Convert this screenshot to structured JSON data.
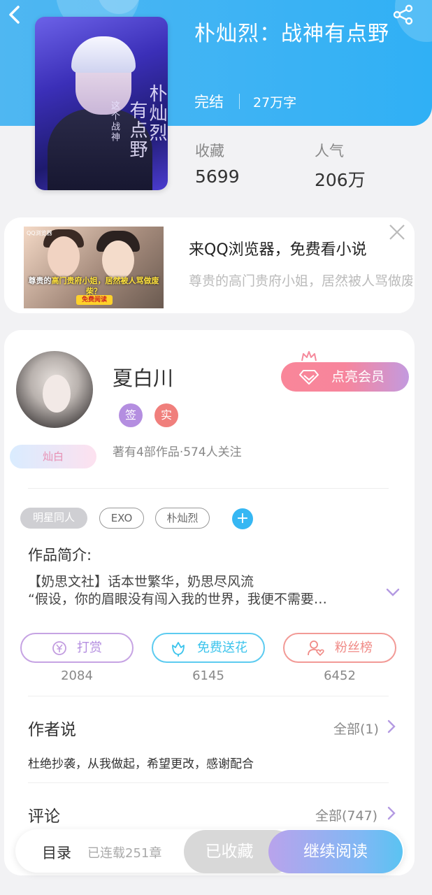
{
  "book": {
    "title": "朴灿烈：战神有点野",
    "status": "完结",
    "word_count": "27万字",
    "cover_text_1": "朴灿烈",
    "cover_text_2": "有点野",
    "cover_text_3": "这个战神",
    "stats": {
      "favorites_label": "收藏",
      "favorites_value": "5699",
      "popularity_label": "人气",
      "popularity_value": "206万"
    }
  },
  "ad": {
    "title": "来QQ浏览器，免费看小说",
    "description": "尊贵的高门贵府小姐，居然被人骂做废柴？",
    "image_caption_a": "尊贵的",
    "image_caption_b": "高门贵府小姐",
    "image_caption_c": "，居然被人骂做废柴？",
    "image_button": "免费阅读",
    "image_logo": "QQ浏览器"
  },
  "author": {
    "name": "夏白川",
    "badge_sign": "签",
    "badge_real": "实",
    "meta": "著有4部作品·574人关注",
    "fan_badge": "灿白",
    "vip_button": "点亮会员"
  },
  "tags": [
    "明星同人",
    "EXO",
    "朴灿烈"
  ],
  "intro": {
    "heading": "作品简介:",
    "line1": "【奶思文社】话本世繁华，奶思尽风流",
    "line2": "“假设，你的眉眼没有闯入我的世界，我便不需要…"
  },
  "actions": {
    "tip_label": "打赏",
    "tip_count": "2084",
    "flower_label": "免费送花",
    "flower_count": "6145",
    "fans_label": "粉丝榜",
    "fans_count": "6452"
  },
  "author_says": {
    "heading": "作者说",
    "more": "全部(1)",
    "text": "杜绝抄袭，从我做起，希望更改，感谢配合"
  },
  "comments": {
    "heading": "评论",
    "more": "全部(747)"
  },
  "bottom_bar": {
    "catalog": "目录",
    "chapters": "已连载251章",
    "favorited": "已收藏",
    "continue": "继续阅读"
  },
  "colors": {
    "header": "#30b0f5",
    "accent_blue": "#36b7f3",
    "tip": "#c29ce0",
    "flower": "#3cc4ec",
    "fans": "#f08a86"
  }
}
